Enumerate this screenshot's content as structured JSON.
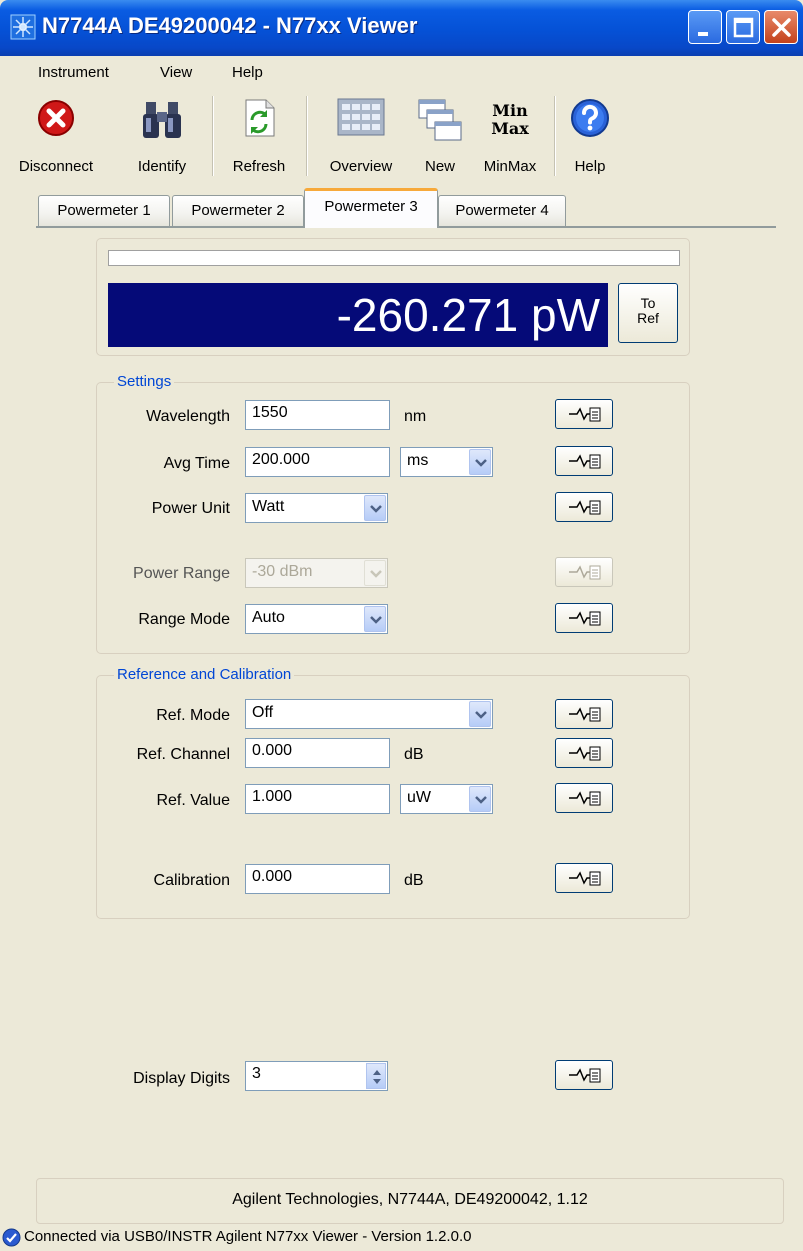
{
  "window": {
    "title": "N7744A DE49200042 - N77xx Viewer"
  },
  "menu": {
    "items": [
      "Instrument",
      "View",
      "Help"
    ]
  },
  "toolbar": {
    "disconnect": "Disconnect",
    "identify": "Identify",
    "refresh": "Refresh",
    "overview": "Overview",
    "new": "New",
    "minmax": "MinMax",
    "minmax_icon_line1": "Min",
    "minmax_icon_line2": "Max",
    "help": "Help"
  },
  "tabs": [
    {
      "label": "Powermeter 1",
      "active": false
    },
    {
      "label": "Powermeter 2",
      "active": false
    },
    {
      "label": "Powermeter 3",
      "active": true
    },
    {
      "label": "Powermeter 4",
      "active": false
    }
  ],
  "reading": {
    "value": "-260.271 pW",
    "progress_fraction": 0.0,
    "to_ref_line1": "To",
    "to_ref_line2": "Ref"
  },
  "settings": {
    "title": "Settings",
    "wavelength": {
      "label": "Wavelength",
      "value": "1550",
      "unit": "nm"
    },
    "avg_time": {
      "label": "Avg Time",
      "value": "200.000",
      "unit": "ms"
    },
    "power_unit": {
      "label": "Power Unit",
      "value": "Watt"
    },
    "power_range": {
      "label": "Power Range",
      "value": "-30 dBm",
      "disabled": true
    },
    "range_mode": {
      "label": "Range Mode",
      "value": "Auto"
    }
  },
  "reference": {
    "title": "Reference and Calibration",
    "ref_mode": {
      "label": "Ref. Mode",
      "value": "Off"
    },
    "ref_channel": {
      "label": "Ref. Channel",
      "value": "0.000",
      "unit": "dB"
    },
    "ref_value": {
      "label": "Ref. Value",
      "value": "1.000",
      "unit": "uW"
    },
    "calibration": {
      "label": "Calibration",
      "value": "0.000",
      "unit": "dB"
    }
  },
  "display_digits": {
    "label": "Display Digits",
    "value": "3"
  },
  "footer": {
    "info": "Agilent Technologies, N7744A, DE49200042, 1.12"
  },
  "status": {
    "text": "Connected via USB0/INSTR  Agilent N77xx Viewer - Version 1.2.0.0"
  },
  "colors": {
    "reading_bg": "#050a78",
    "group_title": "#0046d5",
    "title_bar": "#0551d6",
    "active_tab_accent": "#f7a93a"
  }
}
